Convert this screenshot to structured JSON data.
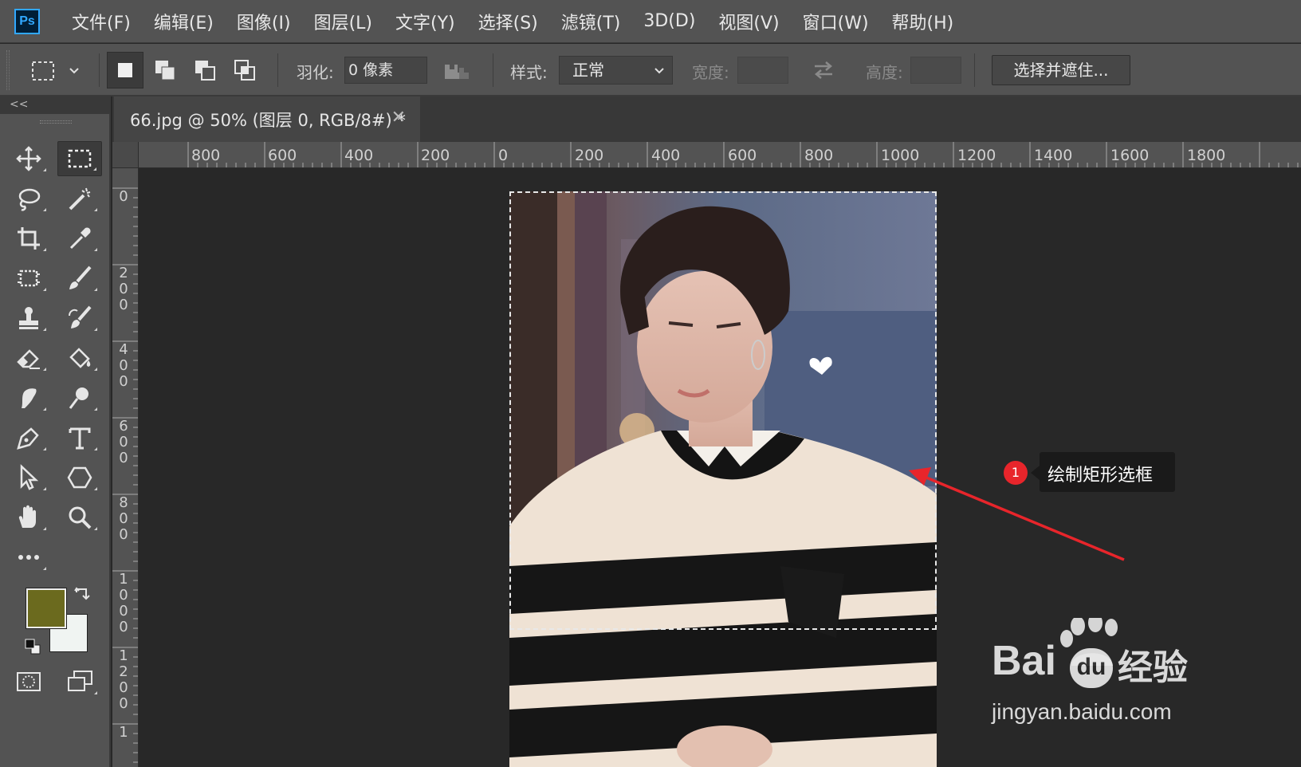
{
  "menubar": {
    "logo": "Ps",
    "items": [
      "文件(F)",
      "编辑(E)",
      "图像(I)",
      "图层(L)",
      "文字(Y)",
      "选择(S)",
      "滤镜(T)",
      "3D(D)",
      "视图(V)",
      "窗口(W)",
      "帮助(H)"
    ]
  },
  "options": {
    "feather_label": "羽化:",
    "feather_value": "0 像素",
    "style_label": "样式:",
    "style_value": "正常",
    "width_label": "宽度:",
    "height_label": "高度:",
    "select_mask_label": "选择并遮住..."
  },
  "toolbar": {
    "collapse_label": "<<",
    "foreground_color": "#6b6a1e",
    "background_color": "#f0f4f2"
  },
  "document": {
    "tab_title": "66.jpg @ 50% (图层 0, RGB/8#) *",
    "close_glyph": "✕"
  },
  "rulers": {
    "horizontal_labels": [
      "800",
      "600",
      "400",
      "200",
      "0",
      "200",
      "400",
      "600",
      "800",
      "1000",
      "1200",
      "1400",
      "1600",
      "1800"
    ],
    "vertical_labels": [
      "0",
      "2\n0\n0",
      "4\n0\n0",
      "6\n0\n0",
      "8\n0\n0",
      "1\n0\n0\n0",
      "1\n2\n0\n0",
      "1"
    ]
  },
  "annotation": {
    "number": "1",
    "text": "绘制矩形选框",
    "arrow_color": "#e8252b"
  },
  "watermark": {
    "brand": "Bai",
    "brand_suffix": "经验",
    "url": "jingyan.baidu.com"
  }
}
